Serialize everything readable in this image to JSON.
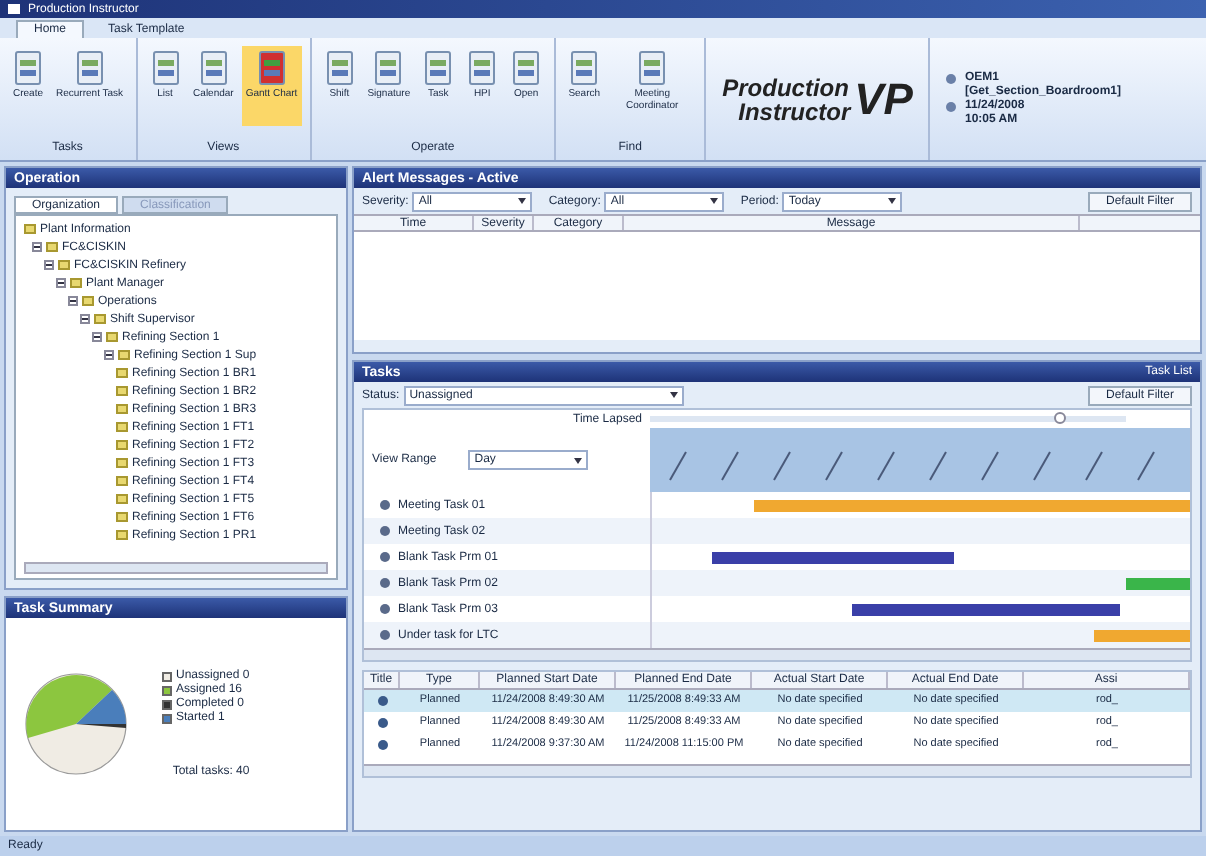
{
  "window": {
    "title": "Production Instructor"
  },
  "ribbon_tabs": [
    {
      "label": "Home",
      "selected": true
    },
    {
      "label": "Task Template",
      "selected": false
    }
  ],
  "ribbon_groups": [
    {
      "label": "Tasks",
      "buttons": [
        {
          "label": "Create",
          "selected": false
        },
        {
          "label": "Recurrent Task",
          "selected": false
        }
      ]
    },
    {
      "label": "Views",
      "buttons": [
        {
          "label": "List",
          "selected": false
        },
        {
          "label": "Calendar",
          "selected": false
        },
        {
          "label": "Gantt Chart",
          "selected": true
        }
      ]
    },
    {
      "label": "Operate",
      "buttons": [
        {
          "label": "Shift",
          "selected": false
        },
        {
          "label": "Signature",
          "selected": false
        },
        {
          "label": "Task",
          "selected": false
        },
        {
          "label": "HPI",
          "selected": false
        },
        {
          "label": "Open",
          "selected": false
        }
      ]
    },
    {
      "label": "Find",
      "buttons": [
        {
          "label": "Search",
          "selected": false
        },
        {
          "label": "Meeting Coordinator",
          "selected": false
        }
      ]
    }
  ],
  "logo": {
    "line_1": "Production",
    "line_2": "Instructor",
    "mark": "VP"
  },
  "user_info": {
    "user": "OEM1",
    "section": "[Get_Section_Boardroom1]",
    "date": "11/24/2008",
    "time": "10:05 AM"
  },
  "operation_panel": {
    "title": "Operation",
    "tabs": [
      {
        "label": "Organization",
        "selected": true
      },
      {
        "label": "Classification",
        "selected": false
      }
    ],
    "tree_header": "Plant Information",
    "tree": [
      {
        "label": "FC&CISKIN",
        "expanded": true,
        "children": [
          {
            "label": "FC&CISKIN Refinery",
            "expanded": true,
            "children": [
              {
                "label": "Plant Manager",
                "expanded": true,
                "children": [
                  {
                    "label": "Operations",
                    "expanded": true,
                    "children": [
                      {
                        "label": "Shift Supervisor",
                        "expanded": true,
                        "children": [
                          {
                            "label": "Refining Section 1",
                            "expanded": true,
                            "children": [
                              {
                                "label": "Refining Section 1 Sup",
                                "expanded": true,
                                "children": [
                                  {
                                    "label": "Refining Section 1 BR1"
                                  },
                                  {
                                    "label": "Refining Section 1 BR2"
                                  },
                                  {
                                    "label": "Refining Section 1 BR3"
                                  },
                                  {
                                    "label": "Refining Section 1 FT1"
                                  },
                                  {
                                    "label": "Refining Section 1 FT2"
                                  },
                                  {
                                    "label": "Refining Section 1 FT3"
                                  },
                                  {
                                    "label": "Refining Section 1 FT4"
                                  },
                                  {
                                    "label": "Refining Section 1 FT5"
                                  },
                                  {
                                    "label": "Refining Section 1 FT6"
                                  },
                                  {
                                    "label": "Refining Section 1 PR1"
                                  }
                                ]
                              }
                            ]
                          }
                        ]
                      }
                    ]
                  }
                ]
              }
            ]
          }
        ]
      }
    ]
  },
  "task_summary": {
    "title": "Task Summary",
    "legend": [
      {
        "label": "Unassigned 0",
        "color": "#f0ece4"
      },
      {
        "label": "Assigned 16",
        "color": "#8cc63f"
      },
      {
        "label": "Completed 0",
        "color": "#333333"
      },
      {
        "label": "Started 1",
        "color": "#4a7ebb"
      }
    ],
    "total": "Total tasks: 40"
  },
  "alert_panel": {
    "title": "Alert Messages - Active",
    "filters": [
      {
        "label": "Severity:",
        "value": "All"
      },
      {
        "label": "Category:",
        "value": "All"
      },
      {
        "label": "Period:",
        "value": "Today"
      }
    ],
    "default_filter": "Default Filter",
    "columns": [
      "Time",
      "Severity",
      "Category",
      "Message"
    ]
  },
  "tasks_panel": {
    "title": "Tasks",
    "view": "Task List",
    "status_label": "Status:",
    "status_value": "Unassigned",
    "default_filter": "Default Filter",
    "time_lapsed": "Time Lapsed",
    "time_slider": {
      "level": 0.86
    },
    "view_range_label": "View Range",
    "view_range_value": "Day",
    "gantt_rows": [
      {
        "label": "Meeting Task 01",
        "color": "#f0a830"
      },
      {
        "label": "Meeting Task 02"
      },
      {
        "label": "Blank Task Prm 01",
        "color": "#3a3fa8"
      },
      {
        "label": "Blank Task Prm 02",
        "color": "#3ab54a"
      },
      {
        "label": "Blank Task Prm 03",
        "color": "#3a3fa8"
      },
      {
        "label": "Under task for LTC",
        "color": "#f0a830"
      }
    ],
    "table": {
      "columns": [
        "Title",
        "Type",
        "Planned Start Date",
        "Planned End Date",
        "Actual Start Date",
        "Actual End Date",
        "Assi"
      ],
      "rows": [
        {
          "selected": true,
          "cells": [
            "",
            "Planned",
            "11/24/2008 8:49:30 AM",
            "11/25/2008 8:49:33 AM",
            "No date specified",
            "No date specified",
            "rod_"
          ]
        },
        {
          "selected": false,
          "cells": [
            "",
            "Planned",
            "11/24/2008 8:49:30 AM",
            "11/25/2008 8:49:33 AM",
            "No date specified",
            "No date specified",
            "rod_"
          ]
        },
        {
          "selected": false,
          "cells": [
            "",
            "Planned",
            "11/24/2008 9:37:30 AM",
            "11/24/2008 11:15:00 PM",
            "No date specified",
            "No date specified",
            "rod_"
          ]
        }
      ]
    }
  },
  "status_bar": "Ready"
}
